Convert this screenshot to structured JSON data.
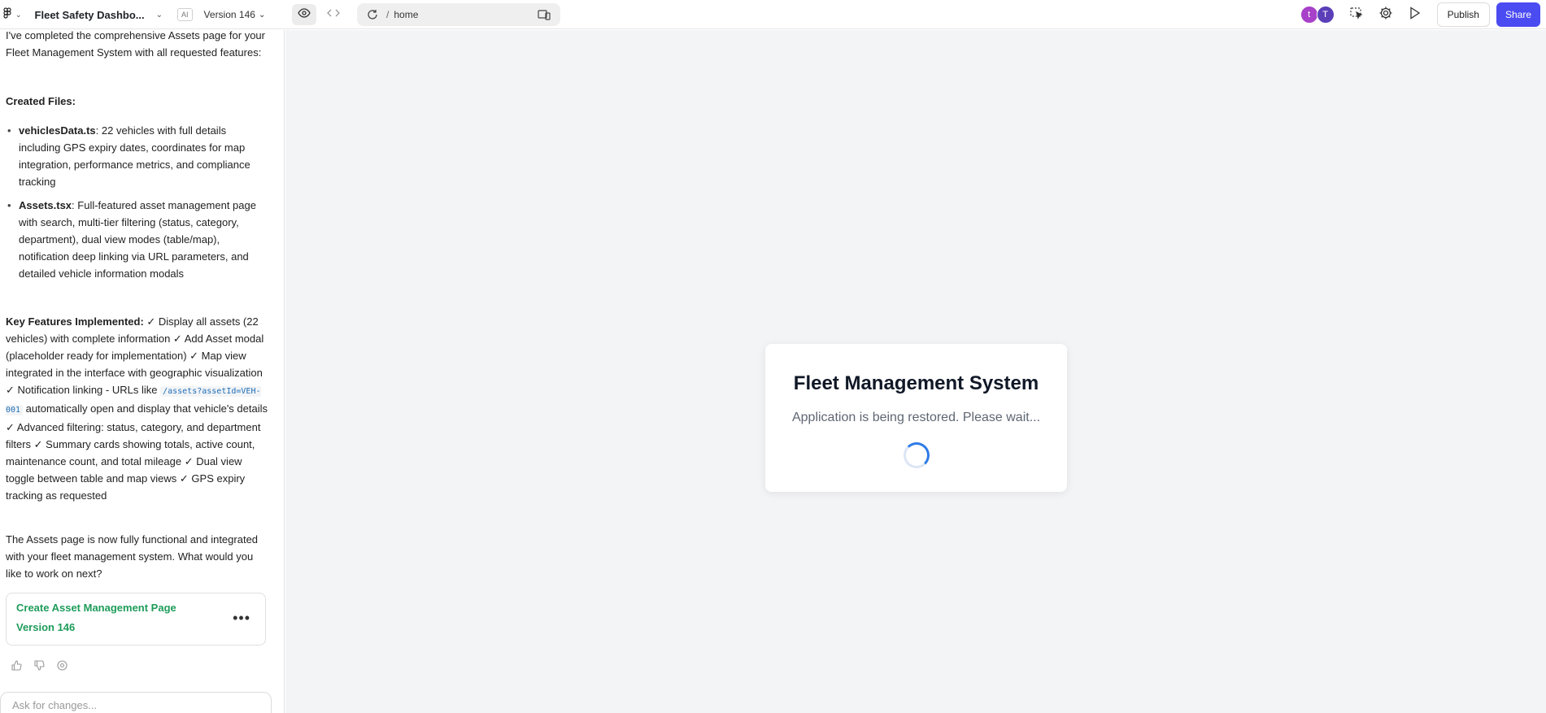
{
  "header": {
    "project_title": "Fleet Safety Dashbo...",
    "ai_badge": "AI",
    "version_label": "Version 146",
    "url_slash": "/",
    "url_path": "home",
    "avatars": [
      "t",
      "T"
    ],
    "publish_label": "Publish",
    "share_label": "Share"
  },
  "chat": {
    "intro": "I've completed the comprehensive Assets page for your Fleet Management System with all requested features:",
    "created_heading": "Created Files:",
    "files": [
      {
        "name": "vehiclesData.ts",
        "desc": ": 22 vehicles with full details including GPS expiry dates, coordinates for map integration, performance metrics, and compliance tracking"
      },
      {
        "name": "Assets.tsx",
        "desc": ": Full-featured asset management page with search, multi-tier filtering (status, category, department), dual view modes (table/map), notification deep linking via URL parameters, and detailed vehicle information modals"
      }
    ],
    "key_features_heading": "Key Features Implemented:",
    "key_features_part1": " ✓ Display all assets (22 vehicles) with complete information ✓ Add Asset modal (placeholder ready for implementation) ✓ Map view integrated in the interface with geographic visualization ✓ Notification linking - URLs like ",
    "key_features_code": "/assets?assetId=VEH-001",
    "key_features_part2": " automatically open and display that vehicle's details ✓ Advanced filtering: status, category, and department filters ✓ Summary cards showing totals, active count, maintenance count, and total mileage ✓ Dual view toggle between table and map views ✓ GPS expiry tracking as requested",
    "closing": "The Assets page is now fully functional and integrated with your fleet management system. What would you like to work on next?",
    "version_card": {
      "title": "Create Asset Management Page",
      "version": "Version 146",
      "more": "•••"
    },
    "input_placeholder": "Ask for changes..."
  },
  "preview": {
    "title": "Fleet Management System",
    "message": "Application is being restored. Please wait..."
  },
  "colors": {
    "accent": "#4b4bf2",
    "version_green": "#1e9c5a",
    "spinner_blue": "#2f7be6"
  }
}
